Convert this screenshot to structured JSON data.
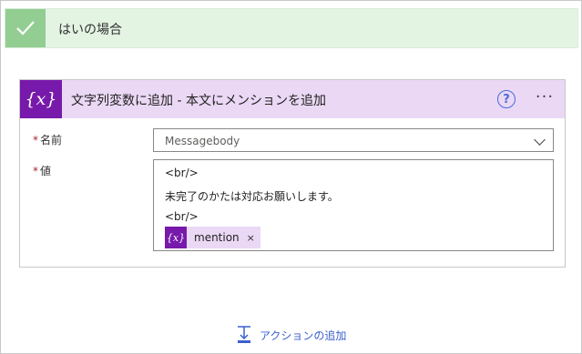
{
  "yes_branch": {
    "title": "はいの場合",
    "icon": "checkmark-icon"
  },
  "action": {
    "icon": "variable-icon",
    "icon_glyph": "{x}",
    "title": "文字列変数に追加 - 本文にメンションを追加",
    "help_glyph": "?",
    "more_glyph": "···"
  },
  "fields": {
    "name": {
      "required_mark": "*",
      "label": "名前",
      "value": "Messagebody"
    },
    "value": {
      "required_mark": "*",
      "label": "値",
      "lines": [
        "<br/>",
        "未完了のかたは対応お願いします。",
        "<br/>"
      ],
      "token": {
        "icon_glyph": "{x}",
        "label": "mention",
        "remove_glyph": "×"
      }
    }
  },
  "add_action": {
    "label": "アクションの追加"
  },
  "colors": {
    "yes_header_bg": "#e3f4e3",
    "yes_check_bg": "#92cd92",
    "variable_purple": "#7719aa",
    "card_header_bg": "#ead8f5",
    "link_blue": "#3a5fcd",
    "required_red": "#a4262c"
  }
}
